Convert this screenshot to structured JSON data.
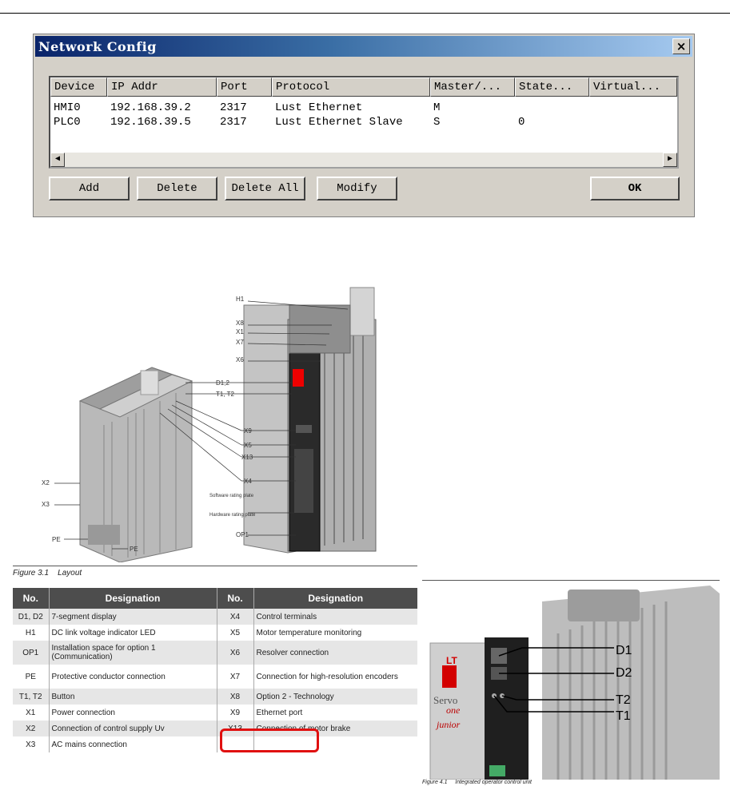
{
  "dialog": {
    "title": "Network Config",
    "close_label": "×",
    "columns": [
      "Device",
      "IP Addr",
      "Port",
      "Protocol",
      "Master/...",
      "State...",
      "Virtual..."
    ],
    "rows": [
      {
        "device": "HMI0",
        "ip": "192.168.39.2",
        "port": "2317",
        "protocol": "Lust Ethernet",
        "master": "M",
        "state": "",
        "virtual": ""
      },
      {
        "device": "PLC0",
        "ip": "192.168.39.5",
        "port": "2317",
        "protocol": "Lust Ethernet Slave",
        "master": "S",
        "state": "0",
        "virtual": ""
      }
    ],
    "buttons": {
      "add": "Add",
      "delete": "Delete",
      "delete_all": "Delete All",
      "modify": "Modify",
      "ok": "OK"
    }
  },
  "figure1": {
    "callouts_right": [
      "H1",
      "X8",
      "X1",
      "X7",
      "X6",
      "D1,2",
      "T1, T2",
      "X9",
      "X5",
      "X13",
      "X4",
      "Software rating plate",
      "Hardware rating plate",
      "OP1"
    ],
    "callouts_left": [
      "X2",
      "X3",
      "PE",
      "PE"
    ],
    "caption_num": "Figure 3.1",
    "caption_text": "Layout"
  },
  "table": {
    "headers": [
      "No.",
      "Designation",
      "No.",
      "Designation"
    ],
    "rows": [
      [
        "D1, D2",
        "7-segment display",
        "X4",
        "Control terminals"
      ],
      [
        "H1",
        "DC link voltage indicator LED",
        "X5",
        "Motor temperature monitoring"
      ],
      [
        "OP1",
        "Installation space for option 1 (Communication)",
        "X6",
        "Resolver connection"
      ],
      [
        "PE",
        "Protective conductor connection",
        "X7",
        "Connection for high-resolution encoders"
      ],
      [
        "T1, T2",
        "Button",
        "X8",
        "Option 2 - Technology"
      ],
      [
        "X1",
        "Power connection",
        "X9",
        "Ethernet port"
      ],
      [
        "X2",
        "Connection of control supply Uv",
        "X13",
        "Connection of motor brake"
      ],
      [
        "X3",
        "AC mains connection",
        "",
        ""
      ]
    ]
  },
  "figure2": {
    "labels": [
      "D1",
      "D2",
      "T2",
      "T1"
    ],
    "brand_text": [
      "LT",
      "Servo",
      "one",
      "junior"
    ],
    "caption_num": "Figure 4.1",
    "caption_text": "Integrated operator control unit"
  },
  "colors": {
    "titlebar_start": "#0a246a",
    "titlebar_end": "#a6caf0",
    "highlight": "#e01010",
    "table_header": "#4d4d4d"
  }
}
